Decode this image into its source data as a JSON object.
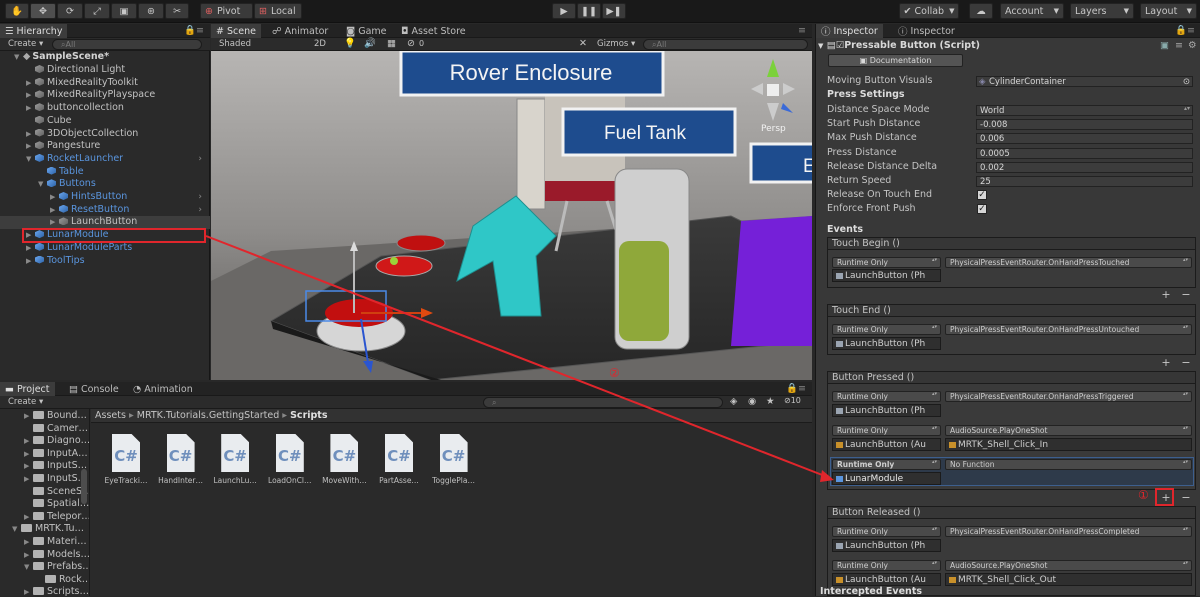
{
  "toolbar": {
    "pivot": "Pivot",
    "local": "Local",
    "collab": "Collab",
    "account": "Account",
    "layers": "Layers",
    "layout": "Layout",
    "tools": [
      "hand-icon",
      "move-icon",
      "rotate-icon",
      "scale-icon",
      "rect-icon",
      "transform-icon",
      "custom-tool-icon"
    ]
  },
  "hierarchy": {
    "tab": "Hierarchy",
    "create": "Create",
    "search_placeholder": "All",
    "scene": "SampleScene*",
    "items": [
      {
        "label": "Directional Light",
        "color": "white"
      },
      {
        "label": "MixedRealityToolkit",
        "color": "white"
      },
      {
        "label": "MixedRealityPlayspace",
        "color": "white"
      },
      {
        "label": "buttoncollection",
        "color": "white"
      },
      {
        "label": "Cube",
        "color": "white"
      },
      {
        "label": "3DObjectCollection",
        "color": "white"
      },
      {
        "label": "Pangesture",
        "color": "white"
      },
      {
        "label": "RocketLauncher",
        "color": "blue"
      },
      {
        "label": "Table",
        "color": "blue"
      },
      {
        "label": "Buttons",
        "color": "blue"
      },
      {
        "label": "HintsButton",
        "color": "blue"
      },
      {
        "label": "ResetButton",
        "color": "blue"
      },
      {
        "label": "LaunchButton",
        "color": "white"
      },
      {
        "label": "LunarModule",
        "color": "blue"
      },
      {
        "label": "LunarModuleParts",
        "color": "blue"
      },
      {
        "label": "ToolTips",
        "color": "blue"
      }
    ]
  },
  "scene": {
    "tabs": [
      "Scene",
      "Animator",
      "Game",
      "Asset Store"
    ],
    "shaded": "Shaded",
    "mode2d": "2D",
    "fx_count": "0",
    "gizmos": "Gizmos",
    "search_placeholder": "All",
    "persp": "Persp",
    "signs": [
      "Rover Enclosure",
      "Fuel Tank",
      "E"
    ],
    "marker2": "②"
  },
  "project": {
    "tabs": [
      "Project",
      "Console",
      "Animation"
    ],
    "create": "Create",
    "breadcrumb": [
      "Assets",
      "MRTK.Tutorials.GettingStarted",
      "Scripts"
    ],
    "visible_count": "10",
    "tree": [
      "Bound…",
      "Camer…",
      "Diagno…",
      "InputA…",
      "InputS…",
      "InputS…",
      "SceneS…",
      "Spatial…",
      "Telepor…",
      "MRTK.Tu…",
      "Materi…",
      "Models…",
      "Prefabs…",
      "Rock…",
      "Scripts…"
    ],
    "files": [
      "EyeTracki…",
      "HandInter…",
      "LaunchLu…",
      "LoadOnCl…",
      "MoveWith…",
      "PartAsse…",
      "TogglePla…"
    ],
    "file_glyph": "C#"
  },
  "inspector": {
    "tabs": [
      "Inspector",
      "Inspector"
    ],
    "component": "Pressable Button (Script)",
    "documentation": "Documentation",
    "moving_visuals_label": "Moving Button Visuals",
    "moving_visuals_value": "CylinderContainer",
    "press_settings": "Press Settings",
    "fields": [
      {
        "label": "Distance Space Mode",
        "value": "World",
        "kind": "drop"
      },
      {
        "label": "Start Push Distance",
        "value": "-0.008",
        "kind": "text"
      },
      {
        "label": "Max Push Distance",
        "value": "0.006",
        "kind": "text"
      },
      {
        "label": "Press Distance",
        "value": "0.0005",
        "kind": "text"
      },
      {
        "label": "Release Distance Delta",
        "value": "0.002",
        "kind": "text"
      },
      {
        "label": "Return Speed",
        "value": "25",
        "kind": "text"
      },
      {
        "label": "Release On Touch End",
        "value": "",
        "kind": "check"
      },
      {
        "label": "Enforce Front Push",
        "value": "",
        "kind": "check"
      }
    ],
    "events_title": "Events",
    "runtime": "Runtime Only",
    "touch_begin": {
      "title": "Touch Begin ()",
      "object": "LaunchButton (Ph",
      "func": "PhysicalPressEventRouter.OnHandPressTouched"
    },
    "touch_end": {
      "title": "Touch End ()",
      "object": "LaunchButton (Ph",
      "func": "PhysicalPressEventRouter.OnHandPressUntouched"
    },
    "button_pressed": {
      "title": "Button Pressed ()",
      "entries": [
        {
          "object": "LaunchButton (Ph",
          "func": "PhysicalPressEventRouter.OnHandPressTriggered",
          "arg": ""
        },
        {
          "object": "LaunchButton (Au",
          "func": "AudioSource.PlayOneShot",
          "arg": "MRTK_Shell_Click_In"
        },
        {
          "object": "LunarModule",
          "func": "No Function",
          "arg": ""
        }
      ]
    },
    "button_released": {
      "title": "Button Released ()",
      "entries": [
        {
          "object": "LaunchButton (Ph",
          "func": "PhysicalPressEventRouter.OnHandPressCompleted",
          "arg": ""
        },
        {
          "object": "LaunchButton (Au",
          "func": "AudioSource.PlayOneShot",
          "arg": "MRTK_Shell_Click_Out"
        }
      ]
    },
    "intercepted": "Intercepted Events",
    "marker1": "①",
    "plus": "+",
    "minus": "−"
  },
  "colors": {
    "annotation": "#e0262c",
    "link_blue": "#5a95de",
    "sound_orange": "#c8902a"
  }
}
